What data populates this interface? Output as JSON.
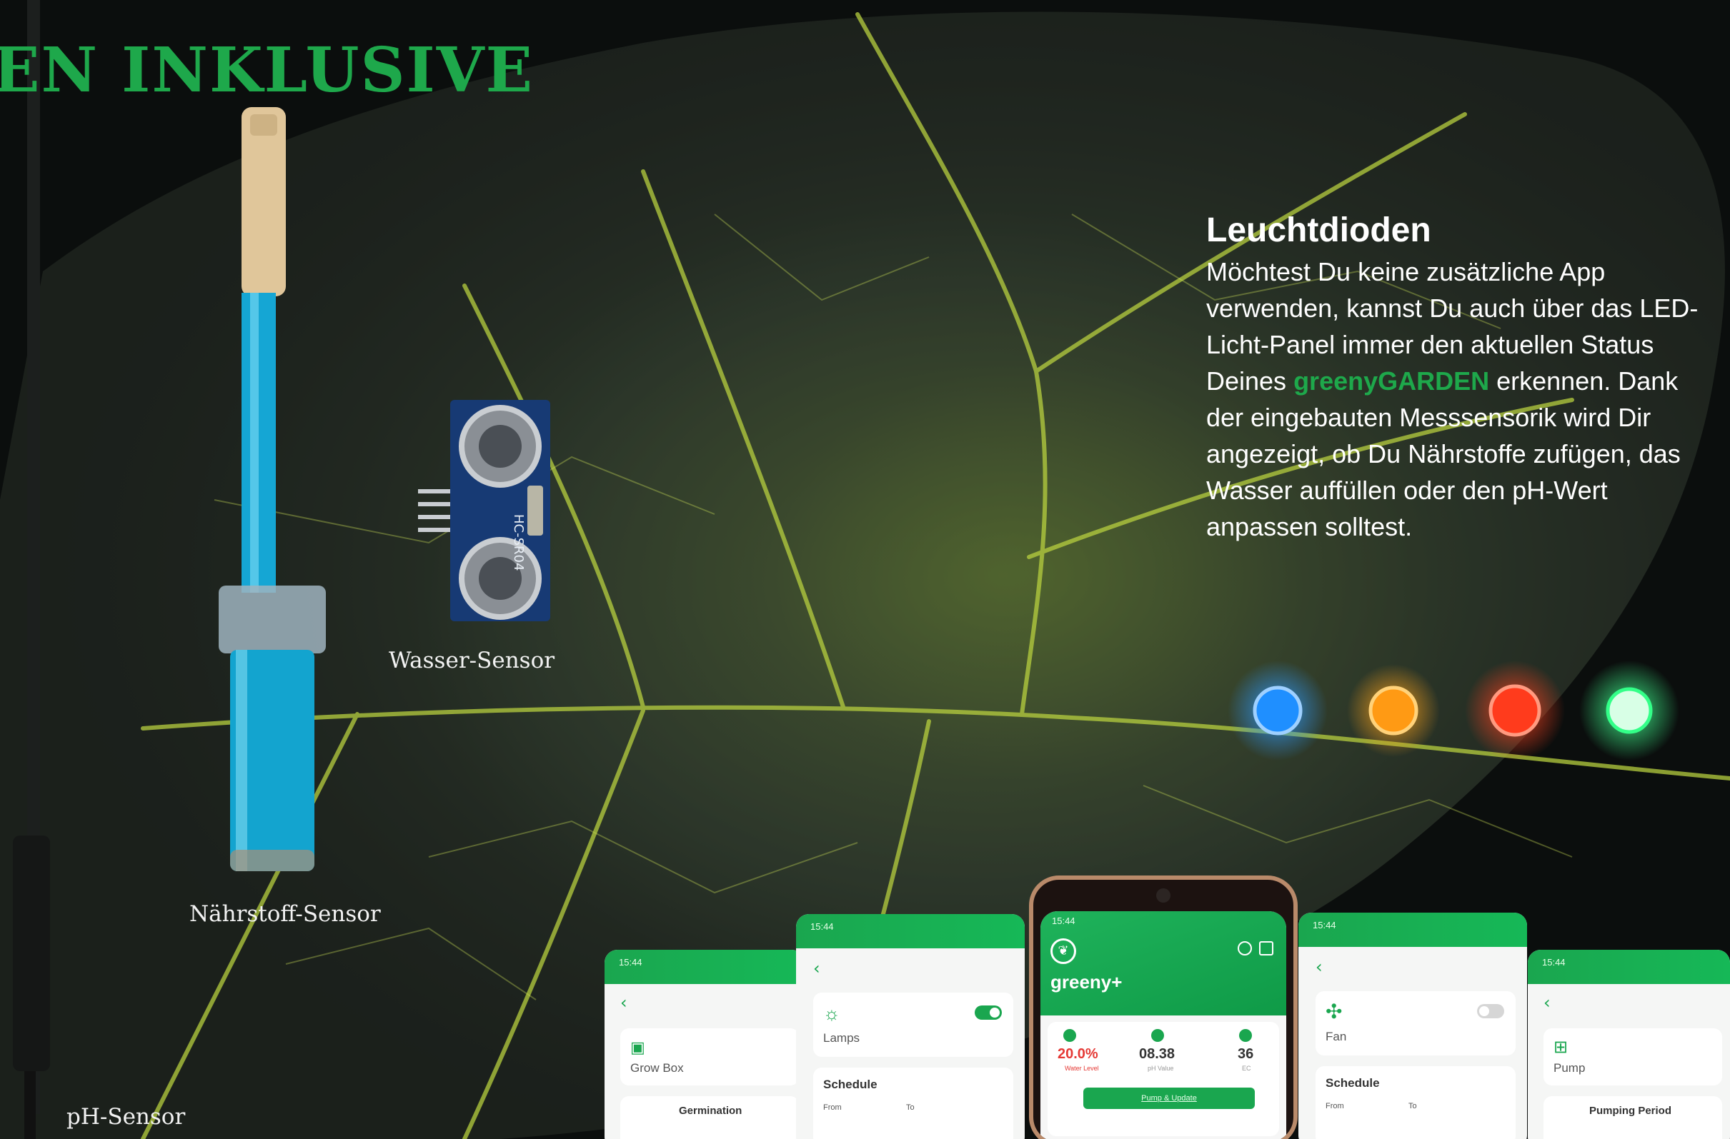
{
  "headline": "EN INKLUSIVE",
  "sensors": {
    "water": "Wasser-Sensor",
    "nutrient": "Nährstoff-Sensor",
    "ph": "pH-Sensor"
  },
  "info": {
    "title": "Leuchtdioden",
    "text_before": "Möchtest Du keine zusätzliche App verwenden, kannst Du auch über das LED-Licht-Panel immer den aktuellen Status Deines ",
    "brand": "greenyGARDEN",
    "text_after": " erkennen. Dank der eingebauten Messsensorik wird Dir angezeigt, ob Du Nährstoffe zufügen, das Wasser auffüllen oder den pH-Wert anpassen solltest."
  },
  "led_colors": [
    "#1f8fff",
    "#ff9a14",
    "#ff3b1c",
    "#33ff88"
  ],
  "sensor_module_text": "HC-SR04",
  "app": {
    "screen1": {
      "time": "15:44",
      "card": "Grow Box",
      "section": "Germination"
    },
    "screen2": {
      "time": "15:44",
      "card": "Lamps",
      "section": "Schedule",
      "from": "From",
      "to": "To"
    },
    "main": {
      "time": "15:44",
      "app_name": "greeny+",
      "water_level": {
        "value": "20.0%",
        "label": "Water Level"
      },
      "ph_value": {
        "value": "08.38",
        "label": "pH Value"
      },
      "ec": {
        "value": "36",
        "label": "EC"
      },
      "button": "Pump & Update"
    },
    "screen4": {
      "time": "15:44",
      "card": "Fan",
      "section": "Schedule",
      "from": "From",
      "to": "To"
    },
    "screen5": {
      "time": "15:44",
      "card": "Pump",
      "section": "Pumping Period"
    }
  }
}
